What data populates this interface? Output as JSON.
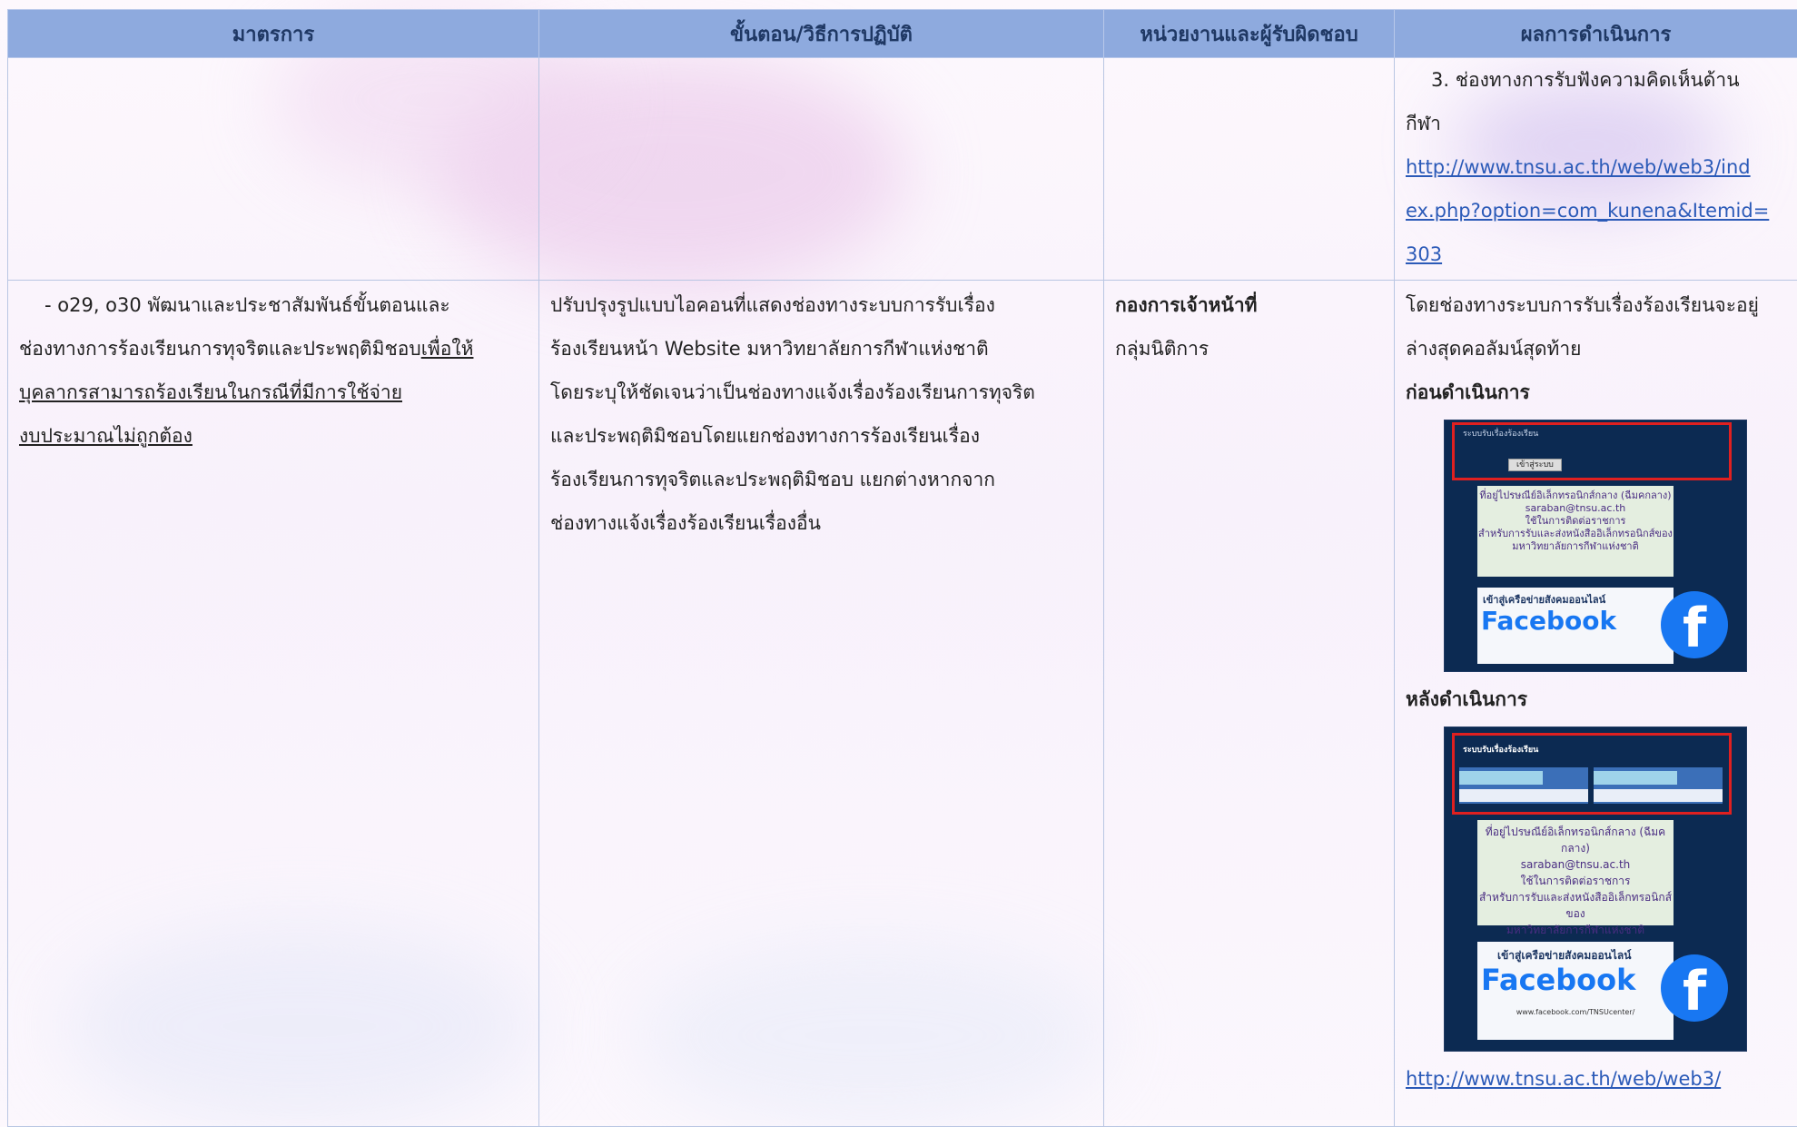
{
  "table": {
    "headers": [
      "มาตรการ",
      "ขั้นตอน/วิธีการปฏิบัติ",
      "หน่วยงานและผู้รับผิดชอบ",
      "ผลการดำเนินการ"
    ],
    "row1": {
      "result_item": "3. ช่องทางการรับฟังความคิดเห็นด้าน",
      "result_cont": "กีฬา",
      "link_lines": [
        "http://www.tnsu.ac.th/web/web3/ind",
        "ex.php?option=com_kunena&Itemid=",
        "303"
      ]
    },
    "row2": {
      "measure_plain_lines": [
        "- o29, o30 พัฒนาและประชาสัมพันธ์ขั้นตอนและ",
        "ช่องทางการร้องเรียนการทุจริตและประพฤติมิชอบ"
      ],
      "measure_underlined_lines": [
        "เพื่อให้",
        "บุคลากรสามารถร้องเรียนในกรณีที่มีการใช้จ่าย",
        "งบประมาณไม่ถูกต้อง"
      ],
      "procedure_lines": [
        "ปรับปรุงรูปแบบไอคอนที่แสดงช่องทางระบบการรับเรื่อง",
        "ร้องเรียนหน้า Website มหาวิทยาลัยการกีฬาแห่งชาติ",
        "โดยระบุให้ชัดเจนว่าเป็นช่องทางแจ้งเรื่องร้องเรียนการทุจริต",
        "และประพฤติมิชอบโดยแยกช่องทางการร้องเรียนเรื่อง",
        "ร้องเรียนการทุจริตและประพฤติมิชอบ แยกต่างหากจาก",
        "ช่องทางแจ้งเรื่องร้องเรียนเรื่องอื่น"
      ],
      "unit_bold": "กองการเจ้าหน้าที่",
      "unit_plain": "กลุ่มนิติการ",
      "result_lines": [
        "โดยช่องทางระบบการรับเรื่องร้องเรียนจะอยู่",
        "ล่างสุดคอลัมน์สุดท้าย"
      ],
      "before_label": "ก่อนดำเนินการ",
      "after_label": "หลังดำเนินการ",
      "bottom_link": "http://www.tnsu.ac.th/web/web3/"
    }
  },
  "screenshots": {
    "before": {
      "header": "ระบบรับเรื่องร้องเรียน",
      "button": "เข้าสู่ระบบ",
      "panel_lines": [
        "ที่อยู่ไปรษณีย์อิเล็กทรอนิกส์กลาง (ฉีมคกลาง)",
        "saraban@tnsu.ac.th",
        "ใช้ในการติดต่อราชการ",
        "สำหรับการรับและส่งหนังสืออิเล็กทรอนิกส์ของ",
        "มหาวิทยาลัยการกีฬาแห่งชาติ"
      ],
      "fb_caption": "เข้าสู่เครือข่ายสังคมออนไลน์",
      "fb_title": "Facebook"
    },
    "after": {
      "header": "ระบบรับเรื่องร้องเรียน",
      "panel_lines": [
        "ที่อยู่ไปรษณีย์อิเล็กทรอนิกส์กลาง (ฉีมคกลาง)",
        "saraban@tnsu.ac.th",
        "ใช้ในการติดต่อราชการ",
        "สำหรับการรับและส่งหนังสืออิเล็กทรอนิกส์ของ",
        "มหาวิทยาลัยการกีฬาแห่งชาติ"
      ],
      "fb_caption": "เข้าสู่เครือข่ายสังคมออนไลน์",
      "fb_title": "Facebook",
      "fb_url": "www.facebook.com/TNSUcenter/"
    }
  }
}
